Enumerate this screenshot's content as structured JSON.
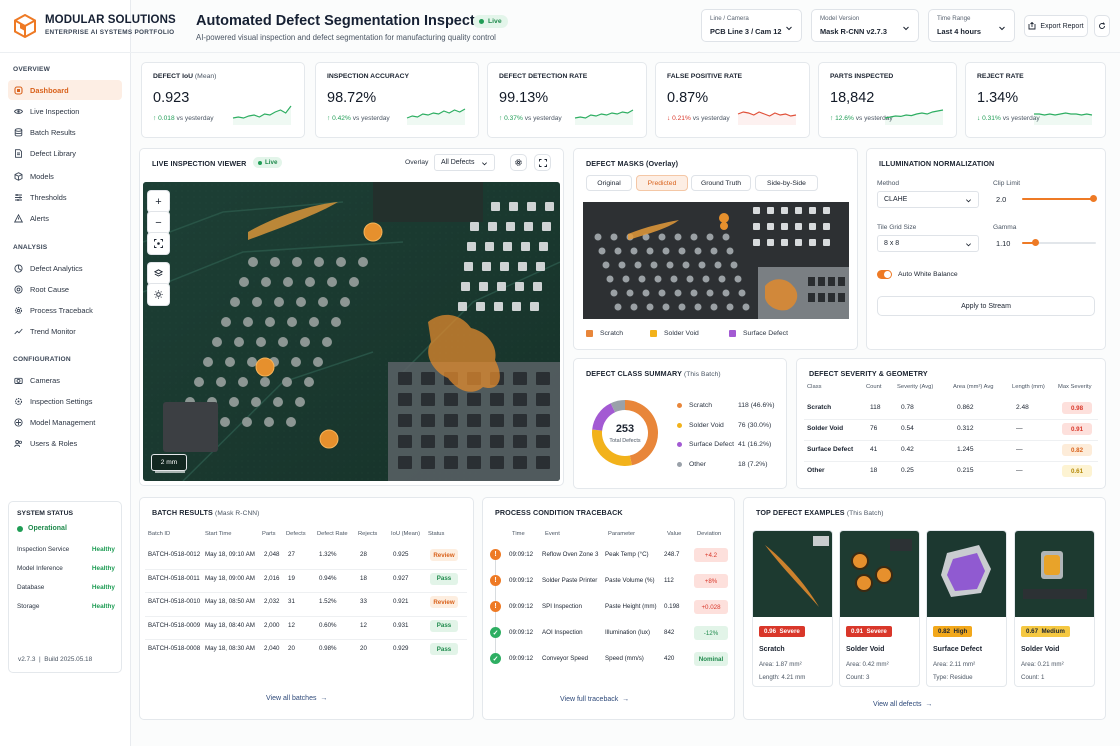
{
  "brand": {
    "name": "MODULAR SOLUTIONS",
    "tagline": "ENTERPRISE AI SYSTEMS PORTFOLIO"
  },
  "sidebar": {
    "sections": [
      {
        "title": "OVERVIEW",
        "items": [
          {
            "label": "Dashboard",
            "icon": "dashboard-icon",
            "active": true
          },
          {
            "label": "Live Inspection",
            "icon": "eye-icon"
          },
          {
            "label": "Batch Results",
            "icon": "database-icon"
          },
          {
            "label": "Defect Library",
            "icon": "document-icon"
          },
          {
            "label": "Models",
            "icon": "cube-icon"
          },
          {
            "label": "Thresholds",
            "icon": "sliders-icon"
          },
          {
            "label": "Alerts",
            "icon": "warning-icon"
          }
        ]
      },
      {
        "title": "ANALYSIS",
        "items": [
          {
            "label": "Defect Analytics",
            "icon": "analytics-icon"
          },
          {
            "label": "Root Cause",
            "icon": "root-cause-icon"
          },
          {
            "label": "Process Traceback",
            "icon": "gear-icon"
          },
          {
            "label": "Trend Monitor",
            "icon": "trend-icon"
          }
        ]
      },
      {
        "title": "CONFIGURATION",
        "items": [
          {
            "label": "Cameras",
            "icon": "camera-icon"
          },
          {
            "label": "Inspection Settings",
            "icon": "settings-icon"
          },
          {
            "label": "Model Management",
            "icon": "model-icon"
          },
          {
            "label": "Users & Roles",
            "icon": "users-icon"
          }
        ]
      }
    ],
    "system_status": {
      "title": "SYSTEM STATUS",
      "overall": "Operational",
      "rows": [
        {
          "name": "Inspection Service",
          "status": "Healthy"
        },
        {
          "name": "Model Inference",
          "status": "Healthy"
        },
        {
          "name": "Database",
          "status": "Healthy"
        },
        {
          "name": "Storage",
          "status": "Healthy"
        }
      ]
    },
    "version": "v2.7.3",
    "build": "Build 2025.05.18"
  },
  "header": {
    "title": "Automated Defect Segmentation Inspector",
    "live": "Live",
    "subtitle": "AI-powered visual inspection and defect segmentation for manufacturing quality control",
    "selects": [
      {
        "label": "Line / Camera",
        "value": "PCB Line 3 / Cam 12"
      },
      {
        "label": "Model Version",
        "value": "Mask R-CNN v2.7.3"
      },
      {
        "label": "Time Range",
        "value": "Last 4 hours"
      }
    ],
    "export": "Export Report"
  },
  "kpis": [
    {
      "label": "DEFECT IoU",
      "sub": "(Mean)",
      "value": "0.923",
      "delta": "0.018",
      "dir": "up",
      "vs": "vs yesterday",
      "color": "#2eae62",
      "trend": [
        0.3,
        0.35,
        0.3,
        0.4,
        0.45,
        0.35,
        0.5,
        0.45,
        0.6,
        0.7,
        0.55,
        0.9
      ]
    },
    {
      "label": "INSPECTION ACCURACY",
      "sub": "",
      "value": "98.72%",
      "delta": "0.42%",
      "dir": "up",
      "vs": "vs yesterday",
      "color": "#2eae62",
      "trend": [
        0.3,
        0.4,
        0.35,
        0.5,
        0.45,
        0.55,
        0.5,
        0.65,
        0.55,
        0.7,
        0.6,
        0.75
      ]
    },
    {
      "label": "DEFECT DETECTION RATE",
      "sub": "",
      "value": "99.13%",
      "delta": "0.37%",
      "dir": "up",
      "vs": "vs yesterday",
      "color": "#2eae62",
      "trend": [
        0.3,
        0.35,
        0.3,
        0.45,
        0.4,
        0.5,
        0.45,
        0.55,
        0.5,
        0.6,
        0.55,
        0.7
      ]
    },
    {
      "label": "FALSE POSITIVE RATE",
      "sub": "",
      "value": "0.87%",
      "delta": "0.21%",
      "dir": "down",
      "vs": "vs yesterday",
      "color": "#e0513a",
      "trend": [
        0.5,
        0.6,
        0.55,
        0.45,
        0.6,
        0.5,
        0.4,
        0.55,
        0.45,
        0.5,
        0.4,
        0.45
      ]
    },
    {
      "label": "PARTS INSPECTED",
      "sub": "",
      "value": "18,842",
      "delta": "12.6%",
      "dir": "up",
      "vs": "vs yesterday",
      "color": "#2eae62",
      "trend": [
        0.3,
        0.35,
        0.4,
        0.38,
        0.45,
        0.42,
        0.5,
        0.55,
        0.5,
        0.6,
        0.65,
        0.7
      ]
    },
    {
      "label": "REJECT RATE",
      "sub": "",
      "value": "1.34%",
      "delta": "0.31%",
      "dir": "down",
      "vs": "vs yesterday",
      "color": "#2eae62",
      "trend": [
        0.5,
        0.5,
        0.45,
        0.5,
        0.45,
        0.5,
        0.55,
        0.5,
        0.5,
        0.45,
        0.5,
        0.45
      ]
    }
  ],
  "viewer": {
    "title": "LIVE INSPECTION VIEWER",
    "live": "Live",
    "overlay_label": "Overlay",
    "overlay_value": "All Defects",
    "scale": "2 mm"
  },
  "masks": {
    "title": "DEFECT MASKS (Overlay)",
    "tabs": [
      "Original",
      "Predicted",
      "Ground Truth",
      "Side-by-Side"
    ],
    "active_tab": 1,
    "legend": [
      {
        "label": "Scratch",
        "color": "#e8863a"
      },
      {
        "label": "Solder Void",
        "color": "#f2b21b"
      },
      {
        "label": "Surface Defect",
        "color": "#a35ad3"
      }
    ]
  },
  "illumination": {
    "title": "ILLUMINATION NORMALIZATION",
    "method_label": "Method",
    "method": "CLAHE",
    "clip_label": "Clip Limit",
    "clip": "2.0",
    "clip_frac": 0.97,
    "tile_label": "Tile Grid Size",
    "tile": "8 x 8",
    "gamma_label": "Gamma",
    "gamma": "1.10",
    "gamma_frac": 0.18,
    "awb": "Auto White Balance",
    "apply": "Apply to Stream"
  },
  "class_summary": {
    "title": "DEFECT CLASS SUMMARY",
    "sub": "(This Batch)",
    "total": "253",
    "total_label": "Total Defects",
    "classes": [
      {
        "name": "Scratch",
        "count": "118",
        "pct": "(46.6%)",
        "value": 118,
        "color": "#e8863a"
      },
      {
        "name": "Solder Void",
        "count": "76",
        "pct": "(30.0%)",
        "value": 76,
        "color": "#f2b21b"
      },
      {
        "name": "Surface Defect",
        "count": "41",
        "pct": "(16.2%)",
        "value": 41,
        "color": "#a35ad3"
      },
      {
        "name": "Other",
        "count": "18",
        "pct": "(7.2%)",
        "value": 18,
        "color": "#9aa1a9"
      }
    ]
  },
  "severity": {
    "title": "DEFECT SEVERITY & GEOMETRY",
    "headers": [
      "Class",
      "Count",
      "Severity (Avg)",
      "Area (mm²) Avg",
      "Length (mm)",
      "Max Severity"
    ],
    "rows": [
      {
        "cls": "Scratch",
        "count": "118",
        "sev": "0.78",
        "area": "0.862",
        "len": "2.48",
        "max": "0.98",
        "bg": "#fde0dc",
        "fg": "#d9372a"
      },
      {
        "cls": "Solder Void",
        "count": "76",
        "sev": "0.54",
        "area": "0.312",
        "len": "—",
        "max": "0.91",
        "bg": "#fde0dc",
        "fg": "#d9372a"
      },
      {
        "cls": "Surface Defect",
        "count": "41",
        "sev": "0.42",
        "area": "1.245",
        "len": "—",
        "max": "0.82",
        "bg": "#fdecd9",
        "fg": "#d9621c"
      },
      {
        "cls": "Other",
        "count": "18",
        "sev": "0.25",
        "area": "0.215",
        "len": "—",
        "max": "0.61",
        "bg": "#fdf3d2",
        "fg": "#b58a0a"
      }
    ]
  },
  "batches": {
    "title": "BATCH RESULTS",
    "sub": "(Mask R-CNN)",
    "headers": [
      "Batch ID",
      "Start Time",
      "Parts",
      "Defects",
      "Defect Rate",
      "Rejects",
      "IoU (Mean)",
      "Status"
    ],
    "rows": [
      {
        "id": "BATCH-0518-0012",
        "start": "May 18, 09:10 AM",
        "parts": "2,048",
        "defects": "27",
        "rate": "1.32%",
        "rejects": "28",
        "iou": "0.925",
        "status": "Review"
      },
      {
        "id": "BATCH-0518-0011",
        "start": "May 18, 09:00 AM",
        "parts": "2,016",
        "defects": "19",
        "rate": "0.94%",
        "rejects": "18",
        "iou": "0.927",
        "status": "Pass"
      },
      {
        "id": "BATCH-0518-0010",
        "start": "May 18, 08:50 AM",
        "parts": "2,032",
        "defects": "31",
        "rate": "1.52%",
        "rejects": "33",
        "iou": "0.921",
        "status": "Review"
      },
      {
        "id": "BATCH-0518-0009",
        "start": "May 18, 08:40 AM",
        "parts": "2,000",
        "defects": "12",
        "rate": "0.60%",
        "rejects": "12",
        "iou": "0.931",
        "status": "Pass"
      },
      {
        "id": "BATCH-0518-0008",
        "start": "May 18, 08:30 AM",
        "parts": "2,040",
        "defects": "20",
        "rate": "0.98%",
        "rejects": "20",
        "iou": "0.929",
        "status": "Pass"
      }
    ],
    "link": "View all batches"
  },
  "traceback": {
    "title": "PROCESS CONDITION TRACEBACK",
    "headers": [
      "Time",
      "Event",
      "Parameter",
      "Value",
      "Deviation"
    ],
    "rows": [
      {
        "time": "09:09:12",
        "event": "Reflow Oven Zone 3",
        "param": "Peak Temp (°C)",
        "value": "248.7",
        "dev": "+4.2",
        "kind": "warn"
      },
      {
        "time": "09:09:12",
        "event": "Solder Paste Printer",
        "param": "Paste Volume (%)",
        "value": "112",
        "dev": "+8%",
        "kind": "warn"
      },
      {
        "time": "09:09:12",
        "event": "SPI Inspection",
        "param": "Paste Height (mm)",
        "value": "0.198",
        "dev": "+0.028",
        "kind": "warn"
      },
      {
        "time": "09:09:12",
        "event": "AOI Inspection",
        "param": "Illumination (lux)",
        "value": "842",
        "dev": "-12%",
        "kind": "ok"
      },
      {
        "time": "09:09:12",
        "event": "Conveyor Speed",
        "param": "Speed (mm/s)",
        "value": "420",
        "dev": "Nominal",
        "kind": "ok"
      }
    ],
    "link": "View full traceback"
  },
  "examples": {
    "title": "TOP DEFECT EXAMPLES",
    "sub": "(This Batch)",
    "items": [
      {
        "score": "0.96",
        "sev": "Severe",
        "name": "Scratch",
        "l1": "Area: 1.87 mm²",
        "l2": "Length: 4.21 mm",
        "bg": "#d9372a",
        "fg": "#fff"
      },
      {
        "score": "0.91",
        "sev": "Severe",
        "name": "Solder Void",
        "l1": "Area: 0.42 mm²",
        "l2": "Count: 3",
        "bg": "#d9372a",
        "fg": "#fff"
      },
      {
        "score": "0.82",
        "sev": "High",
        "name": "Surface Defect",
        "l1": "Area: 2.11 mm²",
        "l2": "Type: Residue",
        "bg": "#f2a81b",
        "fg": "#1b2330"
      },
      {
        "score": "0.67",
        "sev": "Medium",
        "name": "Solder Void",
        "l1": "Area: 0.21 mm²",
        "l2": "Count: 1",
        "bg": "#f5c842",
        "fg": "#1b2330"
      }
    ],
    "link": "View all defects"
  }
}
